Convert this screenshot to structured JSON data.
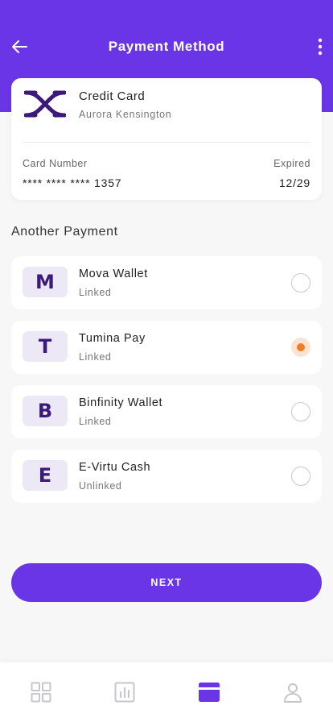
{
  "header": {
    "title": "Payment Method",
    "background_color": "#6a35e6",
    "back_icon": "arrow-left-icon",
    "menu_icon": "more-vertical-icon"
  },
  "card": {
    "logo_icon": "card-brand-logo",
    "type": "Credit Card",
    "holder": "Aurora Kensington",
    "number_label": "Card Number",
    "number": "**** **** **** 1357",
    "expired_label": "Expired",
    "expired": "12/29"
  },
  "another_payment": {
    "title": "Another Payment",
    "items": [
      {
        "logo": "M",
        "name": "Mova Wallet",
        "status": "Linked",
        "selected": false
      },
      {
        "logo": "T",
        "name": "Tumina Pay",
        "status": "Linked",
        "selected": true
      },
      {
        "logo": "B",
        "name": "Binfinity Wallet",
        "status": "Linked",
        "selected": false
      },
      {
        "logo": "E",
        "name": "E-Virtu Cash",
        "status": "Unlinked",
        "selected": false
      }
    ]
  },
  "next_button": {
    "label": "NEXT"
  },
  "bottom_nav": {
    "items": [
      {
        "icon": "grid-icon",
        "active": false
      },
      {
        "icon": "chart-icon",
        "active": false
      },
      {
        "icon": "wallet-icon",
        "active": true
      },
      {
        "icon": "user-icon",
        "active": false
      }
    ]
  },
  "colors": {
    "accent": "#6a35e6",
    "selected_radio": "#f07d2a",
    "inactive_icon": "#c6c6cc"
  }
}
